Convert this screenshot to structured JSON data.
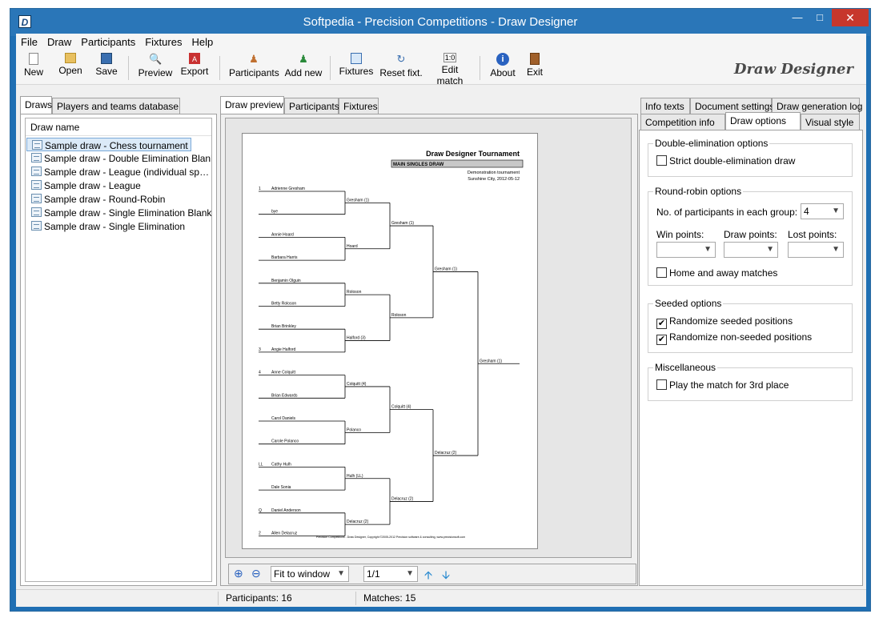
{
  "window": {
    "title": "Softpedia - Precision Competitions - Draw Designer",
    "app_icon": "D"
  },
  "menu": [
    "File",
    "Draw",
    "Participants",
    "Fixtures",
    "Help"
  ],
  "toolbar": {
    "new": "New",
    "open": "Open",
    "save": "Save",
    "preview": "Preview",
    "export": "Export",
    "participants": "Participants",
    "add_new": "Add new",
    "fixtures": "Fixtures",
    "reset_fixt": "Reset fixt.",
    "edit_match": "Edit match",
    "about": "About",
    "exit": "Exit",
    "brand": "Draw Designer"
  },
  "left_tabs": [
    "Draws",
    "Players and teams database"
  ],
  "draws": {
    "header": "Draw name",
    "items": [
      "Sample draw - Chess tournament",
      "Sample draw - Double Elimination Blank",
      "Sample draw - League (individual sp…",
      "Sample draw - League",
      "Sample draw - Round-Robin",
      "Sample draw - Single Elimination Blank",
      "Sample draw - Single Elimination"
    ]
  },
  "center_tabs": [
    "Draw preview",
    "Participants",
    "Fixtures"
  ],
  "sheet": {
    "title": "Draw Designer Tournament",
    "subtitle": "MAIN SINGLES DRAW",
    "event": "Demonstration tournament",
    "place": "Sunshine City, 2012-05-12",
    "footer": "Precision Competitions - Draw Designer, Copyright ©2005-2012 Precision software & consulting, www.precisionsoft.com",
    "seeds": [
      "1",
      "",
      "",
      "",
      "",
      "",
      "",
      "3",
      "4",
      "",
      "",
      "",
      "LL",
      "",
      "Q",
      "2"
    ],
    "players": [
      "Adrienne Gresham",
      "bye",
      "Annie Hoard",
      "Barbara Harris",
      "Benjamin Olguin",
      "Betty Roloson",
      "Brian Brinkley",
      "Angie Halford",
      "Anne Colquitt",
      "Brian Edwards",
      "Carol Daniels",
      "Carole Polanco",
      "Cathy Hulh",
      "Dale Sonia",
      "Daniel Anderson",
      "Allen Delacruz"
    ],
    "r1": [
      "Gresham (1)",
      "Hoard",
      "Roloson",
      "Halford (3)",
      "Colquitt (4)",
      "Polanco",
      "Hulh (LL)",
      "Delacruz (2)"
    ],
    "r2": [
      "Gresham (1)",
      "Roloson",
      "Colquitt (4)",
      "Delacruz (2)"
    ],
    "r3": [
      "Gresham (1)",
      "Delacruz (2)"
    ],
    "winner": "Gresham (1)"
  },
  "preview_bar": {
    "zoom_mode": "Fit to window",
    "page": "1/1"
  },
  "right_tabs": {
    "row1": [
      "Info texts",
      "Document settings",
      "Draw generation log"
    ],
    "row2": [
      "Competition info",
      "Draw options",
      "Visual style"
    ]
  },
  "options": {
    "double_elim": {
      "title": "Double-elimination options",
      "strict": "Strict double-elimination draw",
      "strict_checked": false
    },
    "round_robin": {
      "title": "Round-robin options",
      "participants_label": "No. of participants in each group:",
      "participants_value": "4",
      "win_points": "Win points:",
      "draw_points": "Draw points:",
      "lost_points": "Lost points:",
      "home_away": "Home and away matches",
      "home_away_checked": false
    },
    "seeded": {
      "title": "Seeded options",
      "randomize_seeded": "Randomize seeded positions",
      "randomize_seeded_checked": true,
      "randomize_nonseeded": "Randomize non-seeded positions",
      "randomize_nonseeded_checked": true
    },
    "misc": {
      "title": "Miscellaneous",
      "third_place": "Play the match for 3rd place",
      "third_place_checked": false
    }
  },
  "status": {
    "participants": "Participants: 16",
    "matches": "Matches: 15"
  }
}
